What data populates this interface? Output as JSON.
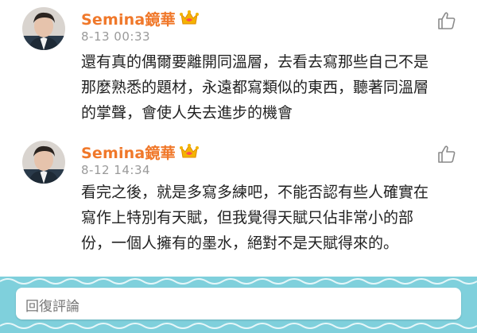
{
  "comments": [
    {
      "username": "Semina鏡華",
      "badge_icon": "crown-badge-icon",
      "time": "8-13 00:33",
      "text": "還有真的偶爾要離開同溫層，去看去寫那些自己不是\n那麼熟悉的題材，永遠都寫類似的東西，聽著同溫層\n的掌聲，會使人失去進步的機會"
    },
    {
      "username": "Semina鏡華",
      "badge_icon": "crown-badge-icon",
      "time": "8-12 14:34",
      "text": "看完之後，就是多寫多練吧，不能否認有些人確實在\n寫作上特別有天賦，但我覺得天賦只佔非常小的部\n份，一個人擁有的墨水，絕對不是天賦得來的。"
    }
  ],
  "reply": {
    "placeholder": "回復評論"
  },
  "colors": {
    "username": "#f0782a",
    "footer": "#7fd0dc"
  }
}
